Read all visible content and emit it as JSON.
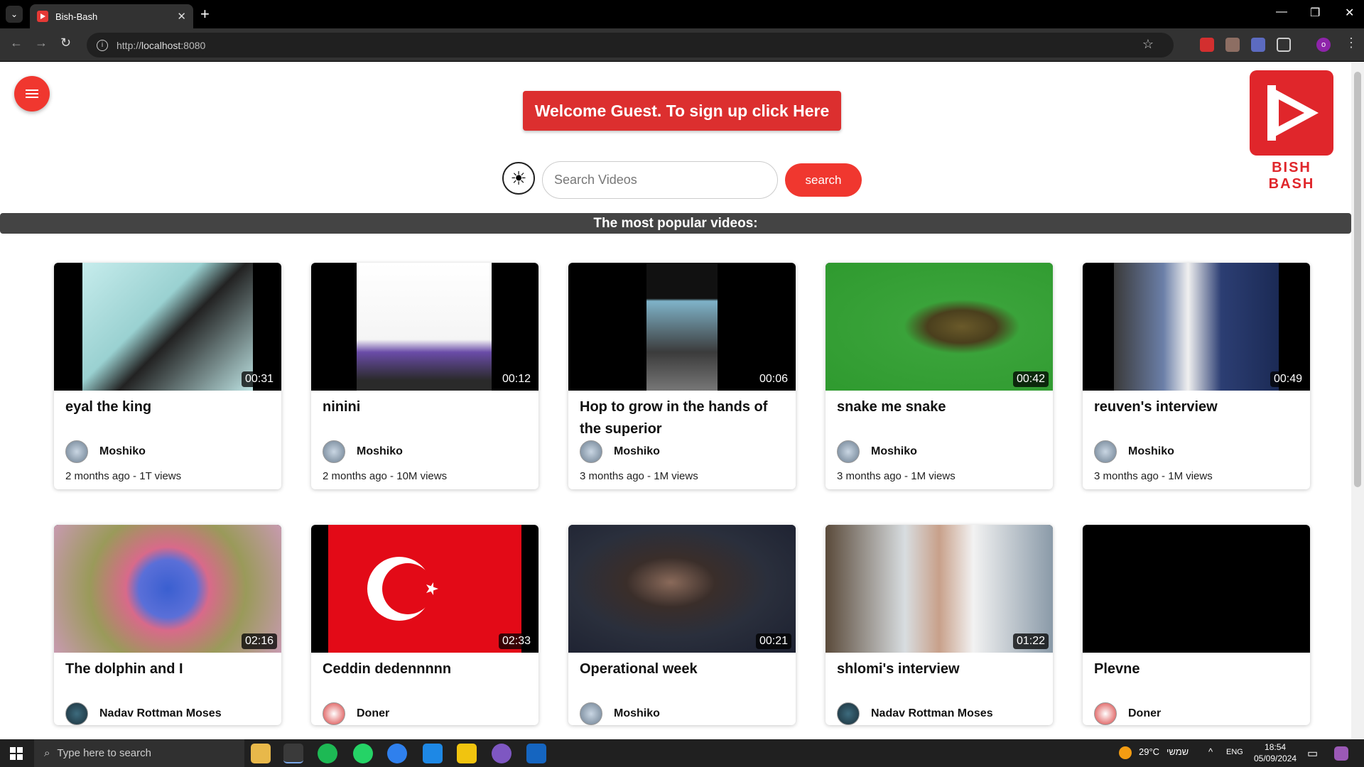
{
  "browser": {
    "tab_title": "Bish-Bash",
    "url_prefix": "http://",
    "url_host": "localhost",
    "url_port": ":8080"
  },
  "header": {
    "welcome_text": "Welcome Guest. To sign up click Here",
    "logo_text": "BISH BASH",
    "search_placeholder": "Search Videos",
    "search_button": "search",
    "section_title": "The most popular videos:"
  },
  "videos": [
    {
      "title": "eyal the king",
      "duration": "00:31",
      "author": "Moshiko",
      "meta": "2 months ago - 1T views"
    },
    {
      "title": "ninini",
      "duration": "00:12",
      "author": "Moshiko",
      "meta": "2 months ago - 10M views"
    },
    {
      "title": "Hop to grow in the hands of the superior",
      "duration": "00:06",
      "author": "Moshiko",
      "meta": "3 months ago - 1M views"
    },
    {
      "title": "snake me snake",
      "duration": "00:42",
      "author": "Moshiko",
      "meta": "3 months ago - 1M views"
    },
    {
      "title": "reuven's interview",
      "duration": "00:49",
      "author": "Moshiko",
      "meta": "3 months ago - 1M views"
    },
    {
      "title": "The dolphin and I",
      "duration": "02:16",
      "author": "Nadav Rottman Moses",
      "meta": ""
    },
    {
      "title": "Ceddin dedennnnn",
      "duration": "02:33",
      "author": "Doner",
      "meta": ""
    },
    {
      "title": "Operational week",
      "duration": "00:21",
      "author": "Moshiko",
      "meta": ""
    },
    {
      "title": "shlomi's interview",
      "duration": "01:22",
      "author": "Nadav Rottman Moses",
      "meta": ""
    },
    {
      "title": "Plevne",
      "duration": "",
      "author": "Doner",
      "meta": ""
    }
  ],
  "taskbar": {
    "search_placeholder": "Type here to search",
    "weather": "29°C",
    "weather_label": "שמשי",
    "language": "ENG",
    "time": "18:54",
    "date": "05/09/2024"
  },
  "colors": {
    "accent": "#f0372f",
    "welcome_bg": "#dc2f2f",
    "section_bar": "#444444"
  }
}
